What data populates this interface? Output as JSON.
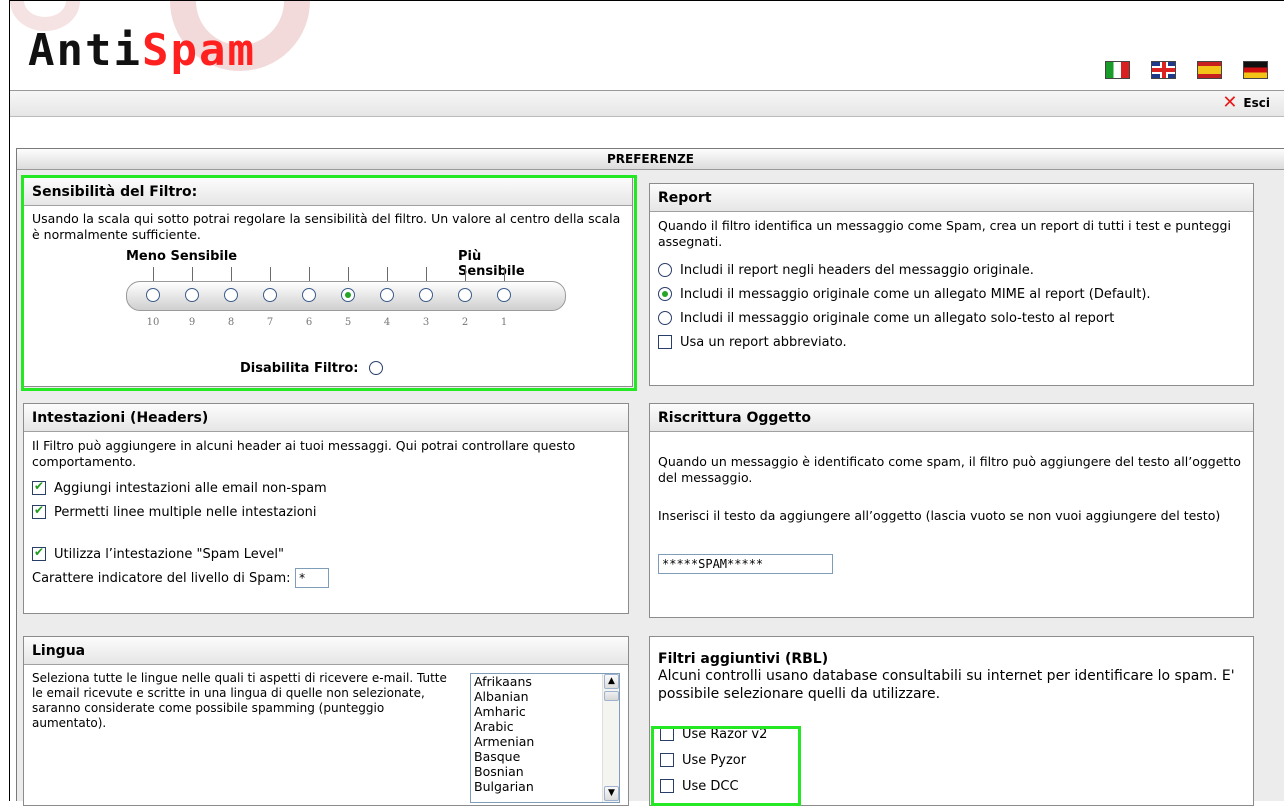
{
  "app": {
    "logo_part1": "Anti",
    "logo_part2": "Spam",
    "languages": [
      "it",
      "en",
      "es",
      "de"
    ],
    "logout_label": "Esci"
  },
  "main_title": "PREFERENZE",
  "sensitivity": {
    "title": "Sensibilità del Filtro:",
    "description": "Usando la scala qui sotto potrai regolare la sensibilità del filtro. Un valore al centro della scala è normalmente sufficiente.",
    "less_label": "Meno Sensibile",
    "more_label": "Più Sensibile",
    "levels": [
      "10",
      "9",
      "8",
      "7",
      "6",
      "5",
      "4",
      "3",
      "2",
      "1"
    ],
    "selected": "5",
    "disable_label": "Disabilita Filtro:",
    "disable_selected": false
  },
  "report": {
    "title": "Report",
    "description": "Quando il filtro identifica un messaggio come Spam, crea un report di tutti i test e punteggi assegnati.",
    "options": [
      {
        "label": "Includi il report negli headers del messaggio originale.",
        "selected": false
      },
      {
        "label": "Includi il messaggio originale come un allegato MIME al report (Default).",
        "selected": true
      },
      {
        "label": "Includi il messaggio originale come un allegato solo-testo al report",
        "selected": false
      }
    ],
    "abbrev_label": "Usa un report abbreviato.",
    "abbrev_checked": false
  },
  "headers": {
    "title": "Intestazioni (Headers)",
    "description": "Il Filtro può aggiungere in alcuni header ai tuoi messaggi. Qui potrai controllare questo comportamento.",
    "opt_add_nonspam": "Aggiungi intestazioni alle email non-spam",
    "opt_multiline": "Permetti linee multiple nelle intestazioni",
    "opt_spam_level": "Utilizza l’intestazione \"Spam Level\"",
    "indicator_label": "Carattere indicatore del livello di Spam:",
    "indicator_value": "*",
    "checked": [
      true,
      true,
      true
    ]
  },
  "subject": {
    "title": "Riscrittura Oggetto",
    "description": "Quando un messaggio è identificato come spam, il filtro può aggiungere del testo all’oggetto del messaggio.",
    "input_label": "Inserisci il testo da aggiungere all’oggetto (lascia vuoto se non vuoi aggiungere del testo)",
    "input_value": "*****SPAM*****"
  },
  "language": {
    "title": "Lingua",
    "description": "Seleziona tutte le lingue nelle quali ti aspetti di ricevere e-mail. Tutte le email ricevute e scritte in una lingua di quelle non selezionate, saranno considerate come possibile spamming (punteggio aumentato).",
    "options": [
      "Afrikaans",
      "Albanian",
      "Amharic",
      "Arabic",
      "Armenian",
      "Basque",
      "Bosnian",
      "Bulgarian"
    ]
  },
  "rbl": {
    "title": "Filtri aggiuntivi (RBL)",
    "description": "Alcuni controlli usano database consultabili su internet per identificare lo spam. E' possibile selezionare quelli da utilizzare.",
    "opt_razor": "Use Razor v2",
    "opt_pyzor": "Use Pyzor",
    "opt_dcc": "Use DCC"
  }
}
